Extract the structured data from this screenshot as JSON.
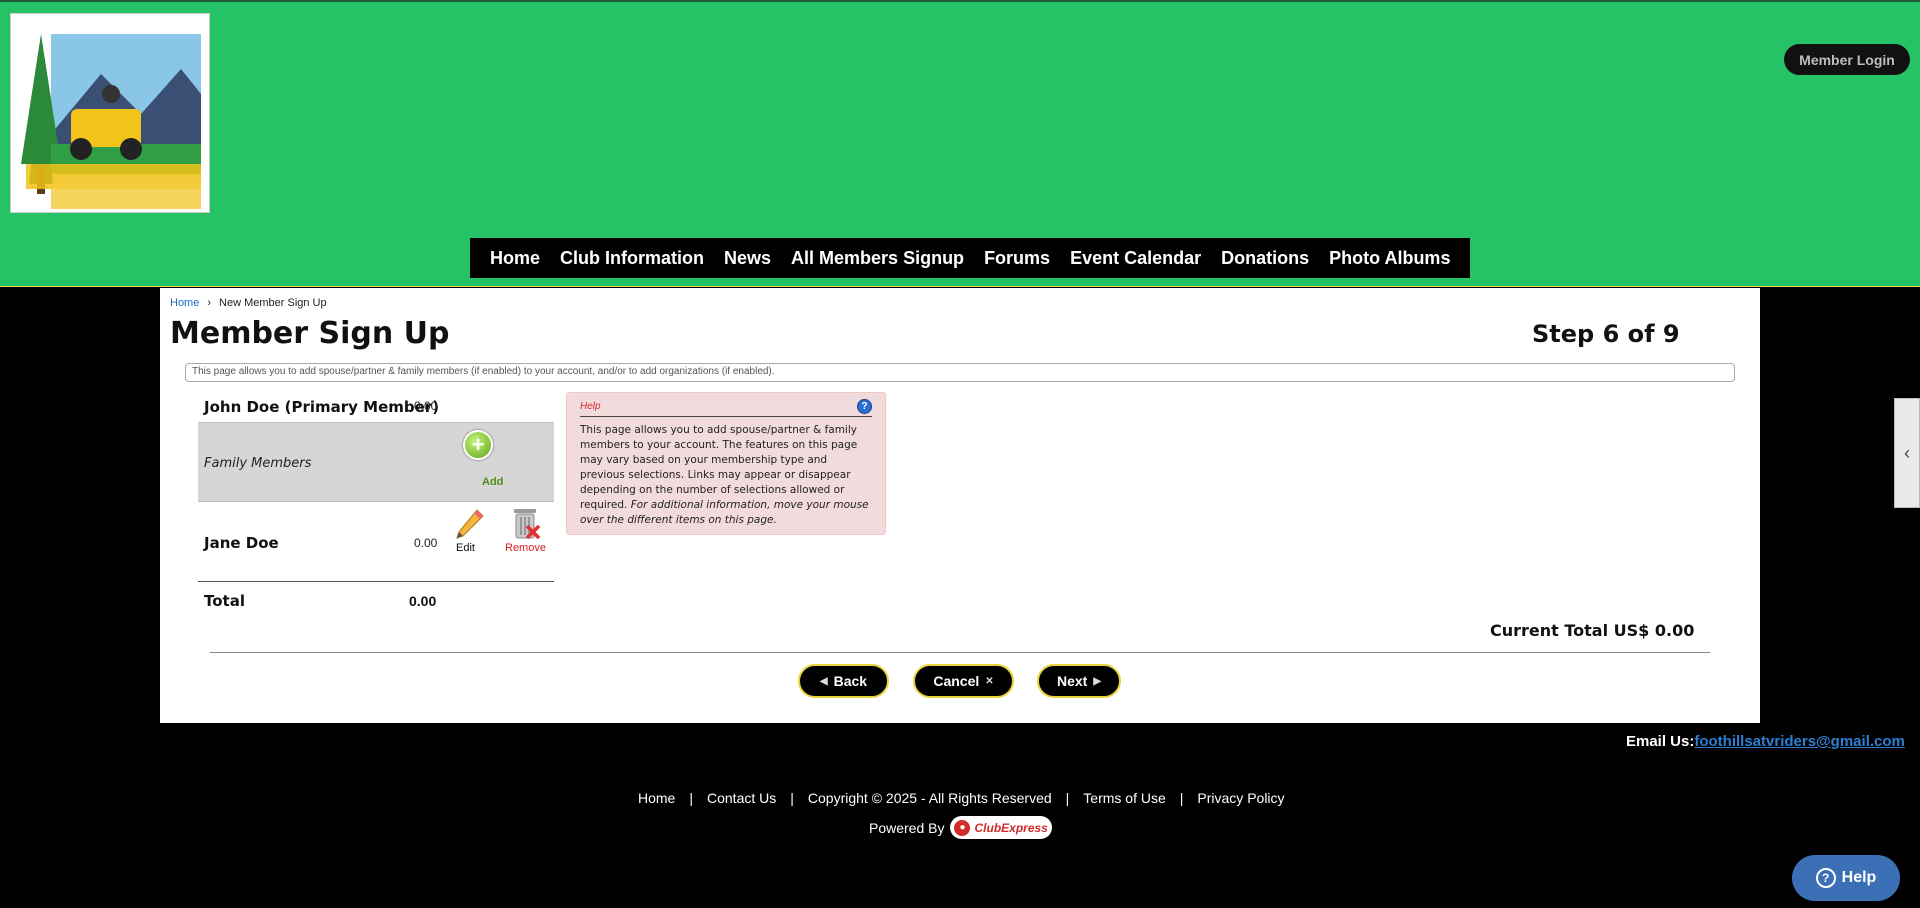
{
  "header": {
    "logo_alt": "Foothills ATV Riders logo",
    "member_login": "Member Login",
    "colors": {
      "header_bg": "#25c366",
      "nav_bg": "#000000"
    }
  },
  "nav": {
    "items": [
      "Home",
      "Club Information",
      "News",
      "All Members Signup",
      "Forums",
      "Event Calendar",
      "Donations",
      "Photo Albums"
    ]
  },
  "breadcrumb": {
    "home": "Home",
    "separator": "›",
    "current": "New Member Sign Up"
  },
  "page": {
    "title": "Member Sign Up",
    "step": "Step 6 of 9",
    "info": "This page allows you to add spouse/partner & family members (if enabled) to your account, and/or to add organizations (if enabled)."
  },
  "members": {
    "primary": {
      "name": "John Doe (Primary Member)",
      "amount": "0.00"
    },
    "family_label": "Family Members",
    "add_label": "Add",
    "family": [
      {
        "name": "Jane Doe",
        "amount": "0.00",
        "edit_label": "Edit",
        "remove_label": "Remove"
      }
    ],
    "total_label": "Total",
    "total_amount": "0.00"
  },
  "help": {
    "title": "Help",
    "text": "This page allows you to add spouse/partner & family members to your account. The features on this page may vary based on your membership type and previous selections. Links may appear or disappear depending on the number of selections allowed or required.",
    "text_italic": "For additional information, move your mouse over the different items on this page."
  },
  "current_total": "Current Total US$ 0.00",
  "buttons": {
    "back": "Back",
    "cancel": "Cancel",
    "next": "Next"
  },
  "footer": {
    "email_label": "Email Us:",
    "email": "foothillsatvriders@gmail.com",
    "links": [
      "Home",
      "Contact Us",
      "Copyright © 2025 - All Rights Reserved",
      "Terms of Use",
      "Privacy Policy"
    ],
    "powered_by": "Powered By",
    "brand": "ClubExpress"
  },
  "help_button": "Help",
  "icons": {
    "add": "plus-circle-icon",
    "edit": "pencil-icon",
    "remove": "trash-icon",
    "help": "question-circle-icon",
    "side_tab": "chevron-left-icon",
    "back": "triangle-left-icon",
    "cancel": "x-icon",
    "next": "triangle-right-icon"
  }
}
